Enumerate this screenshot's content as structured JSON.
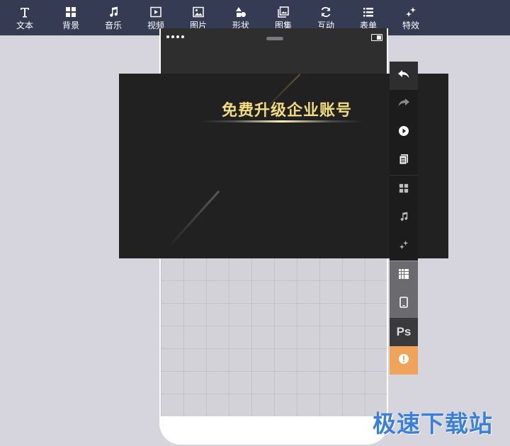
{
  "toolbar": {
    "items": [
      {
        "label": "文本",
        "icon": "text-icon"
      },
      {
        "label": "背景",
        "icon": "grid-icon"
      },
      {
        "label": "音乐",
        "icon": "music-note-icon"
      },
      {
        "label": "视频",
        "icon": "video-play-icon"
      },
      {
        "label": "图片",
        "icon": "image-icon"
      },
      {
        "label": "形状",
        "icon": "shapes-icon"
      },
      {
        "label": "图集",
        "icon": "gallery-icon"
      },
      {
        "label": "互动",
        "icon": "refresh-icon"
      },
      {
        "label": "表单",
        "icon": "list-icon"
      },
      {
        "label": "特效",
        "icon": "sparkle-icon"
      }
    ],
    "background": "#353b52"
  },
  "banner": {
    "title": "免费升级企业账号",
    "title_color": "#f3dc7d"
  },
  "side_panel": {
    "buttons": [
      "undo-icon",
      "redo-icon",
      "preview-play-icon",
      "page-copy-icon",
      "grid-icon",
      "music-note-icon",
      "sparkle-icon",
      "pattern-grid-icon",
      "phone-preview-icon",
      "ps-import",
      "warning-icon"
    ],
    "ps_label": "Ps"
  },
  "watermark": {
    "text": "极速下载站",
    "color": "#3a7fd8"
  }
}
